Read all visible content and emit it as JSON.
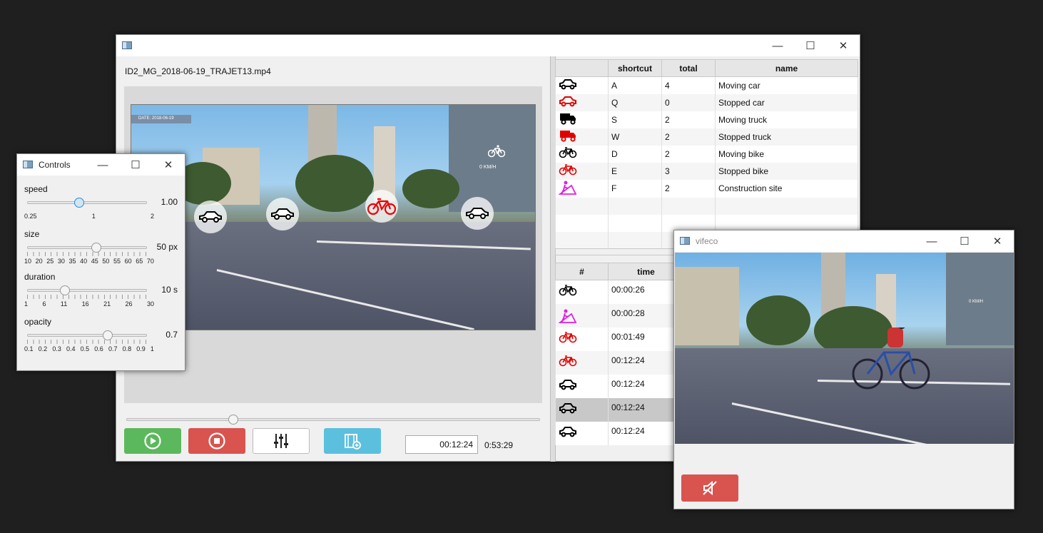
{
  "main_window": {
    "file_name": "ID2_MG_2018-06-19_TRAJET13.mp4",
    "hud_date": "DATE: 2018-06-19",
    "hud_speed": "0 KM/H",
    "current_time": "00:12:24",
    "duration": "0:53:29",
    "colors": {
      "play": "#5cb85c",
      "stop": "#d9534f",
      "add": "#5bc0de"
    },
    "icons": {
      "play": "play-circle-icon",
      "stop": "stop-circle-icon",
      "controls": "sliders-icon",
      "add": "film-add-icon"
    }
  },
  "category_table": {
    "headers": {
      "icon": "",
      "shortcut": "shortcut",
      "total": "total",
      "name": "name"
    },
    "rows": [
      {
        "icon": "moving-car-icon",
        "color": "#000000",
        "shortcut": "A",
        "total": "4",
        "name": "Moving car"
      },
      {
        "icon": "stopped-car-icon",
        "color": "#e00000",
        "shortcut": "Q",
        "total": "0",
        "name": "Stopped car"
      },
      {
        "icon": "moving-truck-icon",
        "color": "#000000",
        "shortcut": "S",
        "total": "2",
        "name": "Moving truck"
      },
      {
        "icon": "stopped-truck-icon",
        "color": "#e00000",
        "shortcut": "W",
        "total": "2",
        "name": "Stopped truck"
      },
      {
        "icon": "moving-bike-icon",
        "color": "#000000",
        "shortcut": "D",
        "total": "2",
        "name": "Moving bike"
      },
      {
        "icon": "stopped-bike-icon",
        "color": "#e00000",
        "shortcut": "E",
        "total": "3",
        "name": "Stopped bike"
      },
      {
        "icon": "construction-site-icon",
        "color": "#e020e0",
        "shortcut": "F",
        "total": "2",
        "name": "Construction site"
      }
    ]
  },
  "event_table": {
    "headers": {
      "num": "#",
      "time": "time"
    },
    "rows": [
      {
        "icon": "moving-bike-icon",
        "color": "#000000",
        "time": "00:00:26"
      },
      {
        "icon": "construction-site-icon",
        "color": "#e020e0",
        "time": "00:00:28"
      },
      {
        "icon": "stopped-bike-icon",
        "color": "#e00000",
        "time": "00:01:49"
      },
      {
        "icon": "stopped-bike-icon",
        "color": "#e00000",
        "time": "00:12:24"
      },
      {
        "icon": "moving-car-icon",
        "color": "#000000",
        "time": "00:12:24"
      },
      {
        "icon": "moving-car-icon",
        "color": "#000000",
        "time": "00:12:24",
        "selected": true
      },
      {
        "icon": "moving-car-icon",
        "color": "#000000",
        "time": "00:12:24"
      }
    ]
  },
  "controls": {
    "title": "Controls",
    "speed": {
      "label": "speed",
      "value": "1.00",
      "ticks": [
        "0.25",
        "1",
        "2"
      ],
      "level": 0.43
    },
    "size": {
      "label": "size",
      "value": "50 px",
      "ticks": [
        "10",
        "20",
        "25",
        "30",
        "35",
        "40",
        "45",
        "50",
        "55",
        "60",
        "65",
        "70"
      ],
      "level": 0.57
    },
    "duration": {
      "label": "duration",
      "value": "10 s",
      "ticks": [
        "1",
        "6",
        "11",
        "16",
        "21",
        "26",
        "30"
      ],
      "level": 0.31
    },
    "opacity": {
      "label": "opacity",
      "value": "0.7",
      "ticks": [
        "0.1",
        "0.2",
        "0.3",
        "0.4",
        "0.5",
        "0.6",
        "0.7",
        "0.8",
        "0.9",
        "1"
      ],
      "level": 0.667
    }
  },
  "vifeco": {
    "title": "vifeco",
    "mute_icon": "mute-icon"
  },
  "window_controls": {
    "minimize": "—",
    "maximize": "☐",
    "close": "✕"
  }
}
